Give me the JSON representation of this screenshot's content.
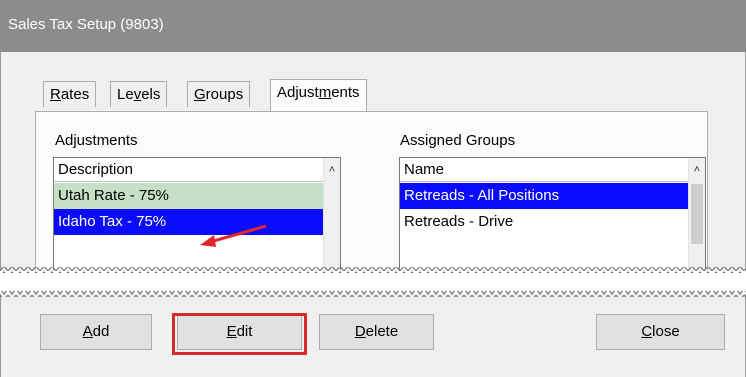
{
  "window": {
    "title": "Sales Tax Setup (9803)"
  },
  "tabs": [
    {
      "pre": "",
      "key": "R",
      "post": "ates",
      "active": false
    },
    {
      "pre": "Le",
      "key": "v",
      "post": "els",
      "active": false
    },
    {
      "pre": "",
      "key": "G",
      "post": "roups",
      "active": false
    },
    {
      "pre": "Adjust",
      "key": "m",
      "post": "ents",
      "active": true
    }
  ],
  "adjustments": {
    "label": "Adjustments",
    "column_header": "Description",
    "rows": [
      "Utah Rate - 75%",
      "Idaho Tax - 75%"
    ]
  },
  "assigned_groups": {
    "label": "Assigned Groups",
    "column_header": "Name",
    "rows": [
      "Retreads - All Positions",
      "Retreads - Drive"
    ]
  },
  "buttons": {
    "add": {
      "key": "A",
      "rest": "dd"
    },
    "edit": {
      "key": "E",
      "rest": "dit"
    },
    "delete": {
      "key": "D",
      "rest": "elete"
    },
    "close": {
      "key": "C",
      "rest": "lose"
    }
  },
  "colors": {
    "selected_row": "#0a0aff",
    "green_row": "#c5e0c5",
    "highlight": "#d62a2a"
  },
  "icons": {
    "scroll_up": "chevron-up-icon",
    "pointer": "red-arrow-icon"
  }
}
